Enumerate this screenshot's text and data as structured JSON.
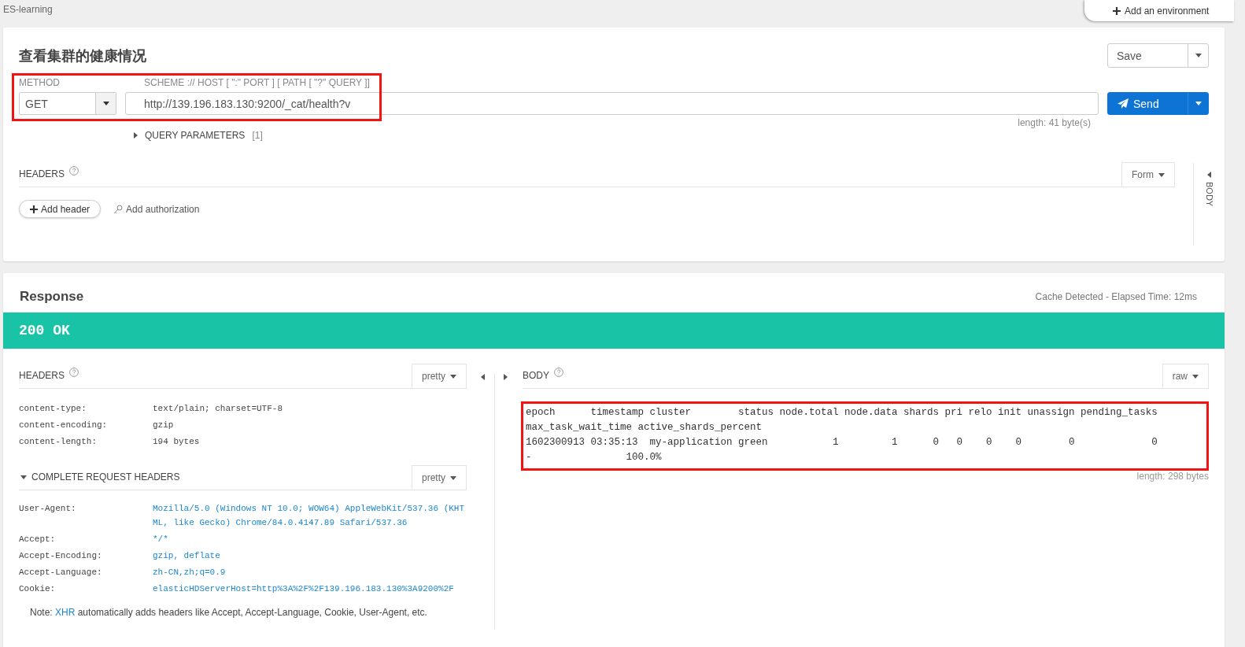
{
  "app": {
    "workspace": "ES-learning",
    "add_environment": "Add an environment"
  },
  "request": {
    "title": "查看集群的健康情况",
    "save_label": "Save",
    "method_label": "METHOD",
    "method": "GET",
    "url_label": "SCHEME :// HOST [ \":\" PORT ] [ PATH [ \"?\" QUERY ]]",
    "url": "http://139.196.183.130:9200/_cat/health?v",
    "send_label": "Send",
    "length": "length: 41 byte(s)",
    "query_params": {
      "label": "QUERY PARAMETERS",
      "count": "[1]",
      "expanded": false
    },
    "headers_label": "HEADERS",
    "format": "Form",
    "add_header": "Add header",
    "add_authorization": "Add authorization",
    "body_tab": "BODY",
    "highlighted": true
  },
  "response": {
    "title": "Response",
    "timing": "Cache Detected - Elapsed Time: 12ms",
    "status": "200 OK",
    "headers": {
      "label": "HEADERS",
      "format": "pretty",
      "rows": [
        {
          "name": "content-type:",
          "value": "text/plain; charset=UTF-8"
        },
        {
          "name": "content-encoding:",
          "value": "gzip"
        },
        {
          "name": "content-length:",
          "value": "194 bytes"
        }
      ]
    },
    "request_headers": {
      "label": "COMPLETE REQUEST HEADERS",
      "expanded": true,
      "format": "pretty",
      "rows": [
        {
          "name": "User-Agent:",
          "value": "Mozilla/5.0 (Windows NT 10.0; WOW64) AppleWebKit/537.36 (KHTML, like Gecko) Chrome/84.0.4147.89 Safari/537.36"
        },
        {
          "name": "Accept:",
          "value": "*/*"
        },
        {
          "name": "Accept-Encoding:",
          "value": "gzip, deflate"
        },
        {
          "name": "Accept-Language:",
          "value": "zh-CN,zh;q=0.9"
        },
        {
          "name": "Cookie:",
          "value": "elasticHDServerHost=http%3A%2F%2F139.196.183.130%3A9200%2F"
        }
      ]
    },
    "note": {
      "before": "Note: ",
      "link": "XHR",
      "after": " automatically adds headers like Accept, Accept-Language, Cookie, User-Agent, etc."
    },
    "body": {
      "label": "BODY",
      "format": "raw",
      "highlighted": true,
      "length": "length: 298 bytes",
      "lines": [
        "epoch      timestamp cluster        status node.total node.data shards pri relo init unassign pending_tasks",
        "max_task_wait_time active_shards_percent",
        "1602300913 03:35:13  my-application green           1         1      0   0    0    0        0             0",
        "-                100.0%"
      ]
    }
  }
}
